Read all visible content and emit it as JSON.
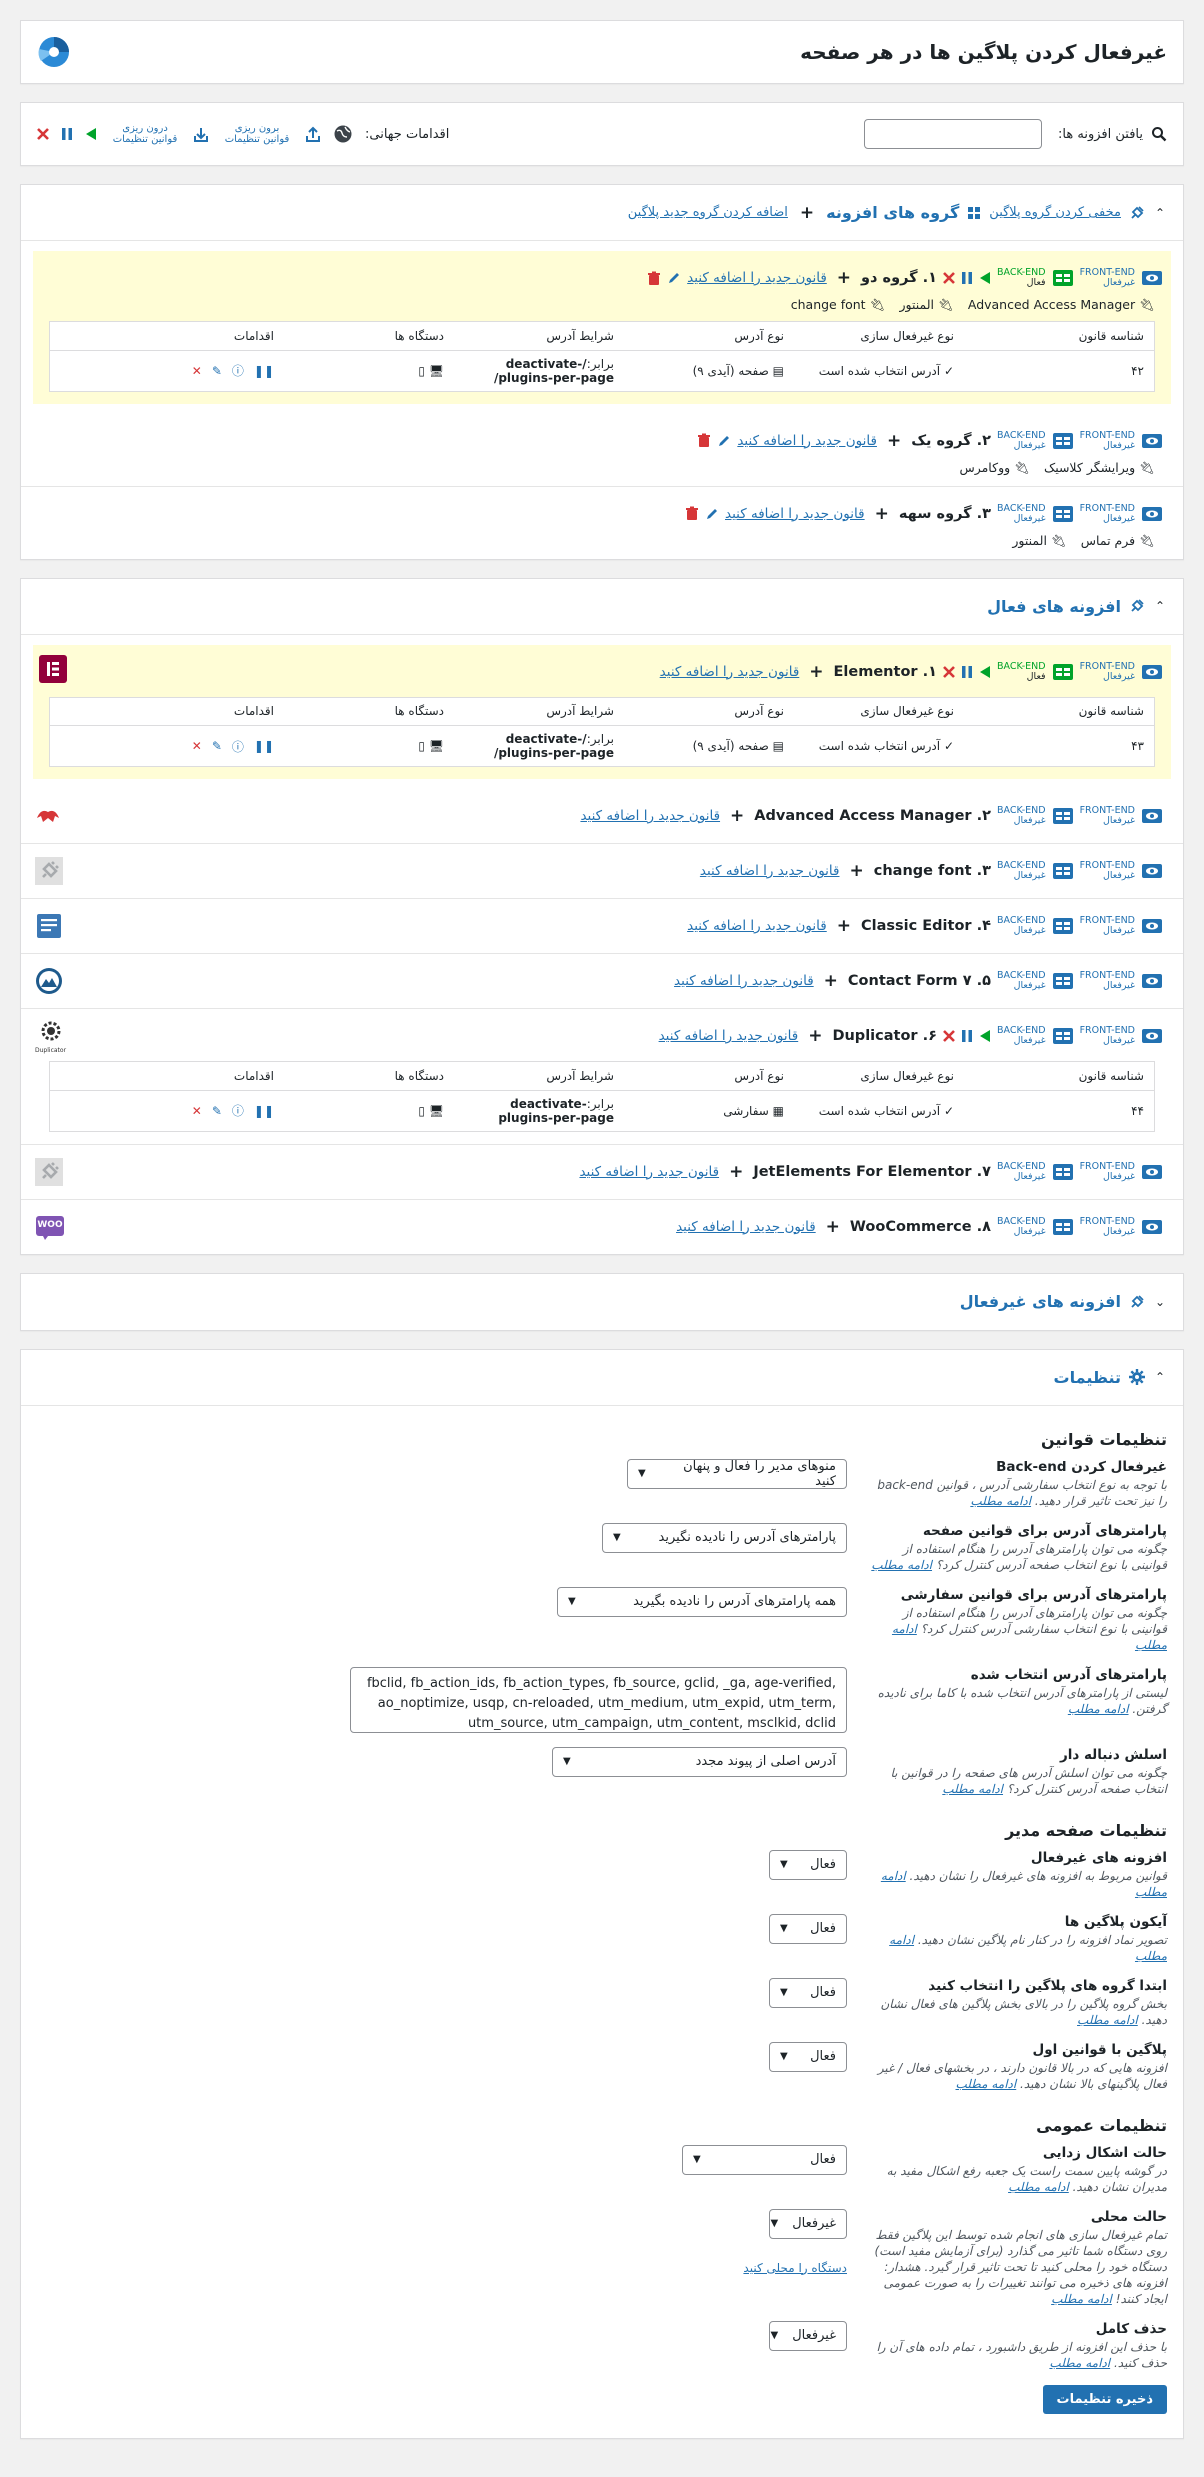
{
  "header": {
    "title": "غیرفعال کردن پلاگین ها در هر صفحه"
  },
  "toolbar": {
    "search_label": "یافتن افزونه ها:",
    "search_value": "",
    "global_actions_label": "اقدامات جهانی:",
    "export_label": "برون ریزی قوانین تنظیمات",
    "import_label": "درون ریزی قوانین تنظیمات"
  },
  "groups_section": {
    "title": "گروه های افزونه",
    "add_link": "اضافه کردن گروه جدید پلاگین",
    "hide_link": "مخفی کردن گروه پلاگین",
    "groups": [
      {
        "name": "۱. گروه دو",
        "add_rule": "قانون جدید را اضافه کنید",
        "members": [
          "Advanced Access Manager",
          "المنتور",
          "change font"
        ],
        "status": "فعال"
      },
      {
        "name": "۲. گروه یک",
        "add_rule": "قانون جدید را اضافه کنید",
        "members": [
          "ویرایشگر کلاسیک",
          "ووکامرس"
        ],
        "status": "غیرفعال"
      },
      {
        "name": "۳. گروه سهه",
        "add_rule": "قانون جدید را اضافه کنید",
        "members": [
          "فرم تماس",
          "المنتور"
        ],
        "status": "غیرفعال"
      }
    ]
  },
  "labels": {
    "front_end": "FRONT-END",
    "back_end": "BACK-END",
    "disabled": "غیرفعال",
    "enabled": "فعال"
  },
  "table_headers": [
    "شناسه قانون",
    "نوع غیرفعال سازی",
    "نوع آدرس",
    "شرایط آدرس",
    "دستگاه ها",
    "اقدامات"
  ],
  "rule_rows": [
    {
      "id": "۴۲",
      "type": "آدرس انتخاب شده است",
      "url_type": "صفحه (آیدی ۹)",
      "cond_prefix": "برابر:",
      "cond": "/deactivate-plugins-per-page/"
    },
    {
      "id": "۴۳",
      "type": "آدرس انتخاب شده است",
      "url_type": "صفحه (آیدی ۹)",
      "cond_prefix": "برابر:",
      "cond": "/deactivate-plugins-per-page/"
    },
    {
      "id": "۴۴",
      "type": "آدرس انتخاب شده است",
      "url_type": "سفارشی",
      "cond_prefix": "برابر:",
      "cond": "deactivate-plugins-per-page"
    }
  ],
  "active_section": {
    "title": "افزونه های فعال",
    "plugins": [
      {
        "name": "۱. Elementor",
        "add_rule": "قانون جدید را اضافه کنید",
        "status": "فعال",
        "icon": "elementor-icon",
        "icon_color": "#92003b"
      },
      {
        "name": "۲. Advanced Access Manager",
        "add_rule": "قانون جدید را اضافه کنید",
        "status": "غیرفعال",
        "icon": "aam-icon",
        "icon_color": "#d63638"
      },
      {
        "name": "۳. change font",
        "add_rule": "قانون جدید را اضافه کنید",
        "status": "غیرفعال",
        "icon": "plug-icon",
        "icon_color": "#a7aaad"
      },
      {
        "name": "۴. Classic Editor",
        "add_rule": "قانون جدید را اضافه کنید",
        "status": "غیرفعال",
        "icon": "classic-editor-icon",
        "icon_color": "#3c78b5"
      },
      {
        "name": "۵. Contact Form ۷",
        "add_rule": "قانون جدید را اضافه کنید",
        "status": "غیرفعال",
        "icon": "contact-form-icon",
        "icon_color": "#1e5a8c"
      },
      {
        "name": "۶. Duplicator",
        "add_rule": "قانون جدید را اضافه کنید",
        "status": "غیرفعال",
        "icon": "duplicator-icon",
        "icon_color": "#333333",
        "icon_caption": "Duplicator"
      },
      {
        "name": "۷. JetElements For Elementor",
        "add_rule": "قانون جدید را اضافه کنید",
        "status": "غیرفعال",
        "icon": "plug-icon",
        "icon_color": "#a7aaad"
      },
      {
        "name": "۸. WooCommerce",
        "add_rule": "قانون جدید را اضافه کنید",
        "status": "غیرفعال",
        "icon": "woo-icon",
        "icon_color": "#7f54b3",
        "icon_text": "WOO"
      }
    ]
  },
  "inactive_section": {
    "title": "افزونه های غیرفعال"
  },
  "settings": {
    "title": "تنظیمات",
    "rules_heading": "تنظیمات قوانین",
    "admin_heading": "تنظیمات صفحه مدیر",
    "general_heading": "تنظیمات عمومی",
    "read_more": "ادامه مطلب",
    "items": {
      "backend": {
        "label": "غیرفعال کردن Back-end",
        "desc": "با توجه به نوع انتخاب سفارشی آدرس ، قوانین back-end را نیز تحت تاثیر قرار دهید.",
        "value": "منوهای مدیر را فعال و پنهان کنید"
      },
      "page_params": {
        "label": "پارامترهای آدرس برای قوانین صفحه",
        "desc": "چگونه می توان پارامترهای آدرس را هنگام استفاده از قوانینی با نوع انتخاب صفحه آدرس کنترل کرد؟",
        "value": "پارامترهای آدرس را نادیده نگیرید"
      },
      "custom_params": {
        "label": "پارامترهای آدرس برای قوانین سفارشی",
        "desc": "چگونه می توان پارامترهای آدرس را هنگام استفاده از قوانینی با نوع انتخاب سفارشی آدرس کنترل کرد؟",
        "value": "همه پارامترهای آدرس را نادیده بگیرید"
      },
      "selected_params": {
        "label": "پارامترهای آدرس انتخاب شده",
        "desc": "لیستی از پارامترهای آدرس انتخاب شده با کاما برای نادیده گرفتن.",
        "value": "fbclid, fb_action_ids, fb_action_types, fb_source, gclid, _ga, age-verified, ao_noptimize, usqp, cn-reloaded, utm_medium, utm_expid, utm_term, utm_source, utm_campaign, utm_content, msclkid, dclid"
      },
      "trailing": {
        "label": "اسلش دنباله دار",
        "desc": "چگونه می توان اسلش آدرس های صفحه را در قوانین با انتخاب صفحه آدرس کنترل کرد؟",
        "value": "آدرس اصلی از پیوند مجدد"
      },
      "inactive_plugins": {
        "label": "افزونه های غیرفعال",
        "desc": "قوانین مربوط به افزونه های غیرفعال را نشان دهید.",
        "value": "فعال"
      },
      "plugin_icons": {
        "label": "آیکون پلاگین ها",
        "desc": "تصویر نماد افزونه را در کنار نام پلاگین نشان دهید.",
        "value": "فعال"
      },
      "groups_first": {
        "label": "ابتدا گروه های پلاگین را انتخاب کنید",
        "desc": "بخش گروه پلاگین را در بالای بخش پلاگین های فعال نشان دهید.",
        "value": "فعال"
      },
      "rules_first": {
        "label": "پلاگین با قوانین اول",
        "desc": "افزونه هایی که در بالا قانون دارند ، در بخشهای فعال / غیر فعال پلاگینهای بالا نشان دهید.",
        "value": "فعال"
      },
      "debug": {
        "label": "حالت اشکال زدایی",
        "desc": "در گوشه پایین سمت راست یک جعبه رفع اشکال مفید به مدیران نشان دهید.",
        "value": "فعال"
      },
      "local": {
        "label": "حالت محلی",
        "desc": "تمام غیرفعال سازی های انجام شده توسط این پلاگین فقط روی دستگاه شما تاثیر می گذارد (برای آزمایش مفید است) دستگاه خود را محلی کنید تا تحت تاثیر قرار گیرد. هشدار: افزونه های ذخیره می توانند تغییرات را به صورت عمومی ایجاد کنند!",
        "value": "غیرفعال",
        "extra_link": "دستگاه را محلی کنید"
      },
      "uninstall": {
        "label": "حذف کامل",
        "desc": "با حذف این افزونه از طریق داشبورد ، تمام داده های آن را حذف کنید.",
        "value": "غیرفعال"
      }
    },
    "save_label": "ذخیره تنظیمات"
  }
}
